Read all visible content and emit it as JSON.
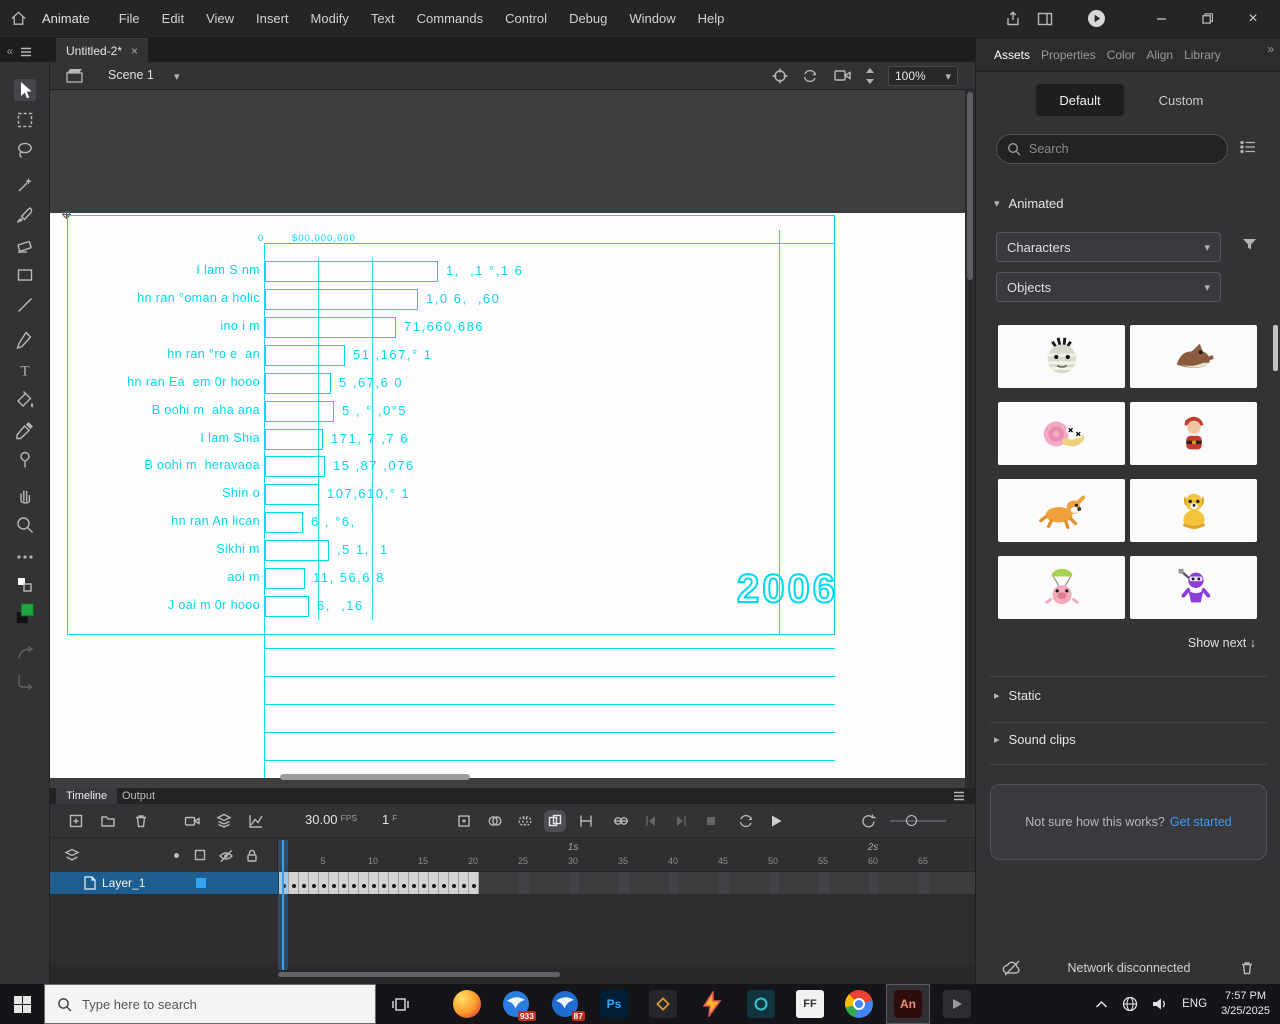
{
  "menubar": {
    "app": "Animate",
    "items": [
      "File",
      "Edit",
      "View",
      "Insert",
      "Modify",
      "Text",
      "Commands",
      "Control",
      "Debug",
      "Window",
      "Help"
    ]
  },
  "document": {
    "tab_title": "Untitled-2*"
  },
  "editbar": {
    "scene": "Scene 1",
    "zoom": "100%"
  },
  "stage": {
    "chart": {
      "axis_zero": "0",
      "axis_max": "$00,000,000",
      "watermark_year": "2006",
      "rows": [
        {
          "label": "I lam S nm",
          "value": "1,  ,1 °,1 6",
          "bar": 173
        },
        {
          "label": "hn ran °oman a holic",
          "value": "1,0 6,  ,60",
          "bar": 153
        },
        {
          "label": "ino i m",
          "value": "71,660,686",
          "bar": 131
        },
        {
          "label": "hn ran °ro e  an",
          "value": "51 ,167,° 1",
          "bar": 80
        },
        {
          "label": "hn ran Ea  em 0r hooo",
          "value": "5 ,67,6 0",
          "bar": 66
        },
        {
          "label": "B oohi m  aha ana",
          "value": "5 , ° ,0°5",
          "bar": 69
        },
        {
          "label": "I lam Shia",
          "value": "171, 7 ,7 6",
          "bar": 58
        },
        {
          "label": "B oohi m  heravaoa",
          "value": "15 ,87 ,076",
          "bar": 60
        },
        {
          "label": "Shin o",
          "value": "107,610,° 1",
          "bar": 54
        },
        {
          "label": "hn ran An lican",
          "value": "6 , °6,",
          "bar": 38
        },
        {
          "label": "Sikhi m",
          "value": ",5 1,  1",
          "bar": 64
        },
        {
          "label": "aoi m",
          "value": "11, 56,6 8",
          "bar": 40
        },
        {
          "label": "J oai m 0r hooo",
          "value": "6,  ,16",
          "bar": 44
        }
      ]
    }
  },
  "timeline": {
    "tabs": [
      "Timeline",
      "Output"
    ],
    "fps_value": "30.00",
    "fps_unit": "FPS",
    "frame_value": "1",
    "frame_unit": "F",
    "layer_name": "Layer_1",
    "keyframe_count": 20,
    "ruler_numbers": [
      5,
      10,
      15,
      20,
      25,
      30,
      35,
      40,
      45,
      50,
      55,
      60,
      65
    ],
    "time_marks": [
      "1s",
      "2s"
    ]
  },
  "assets_panel": {
    "tabs": [
      "Assets",
      "Properties",
      "Color",
      "Align",
      "Library"
    ],
    "active_tab": "Assets",
    "mode_default": "Default",
    "mode_custom": "Custom",
    "search_placeholder": "Search",
    "section_animated": "Animated",
    "dropdown_characters": "Characters",
    "dropdown_objects": "Objects",
    "items": [
      "mummy",
      "wolf",
      "snail",
      "santa",
      "dog-running",
      "dog-sitting",
      "pig-parachute",
      "ninja"
    ],
    "show_next": "Show next ↓",
    "section_static": "Static",
    "section_sound": "Sound clips",
    "help_text": "Not sure how this works?",
    "help_link": "Get started",
    "network_status": "Network disconnected"
  },
  "taskbar": {
    "search_placeholder": "Type here to search",
    "badge_mail_1": "933",
    "badge_mail_2": "87",
    "photoshop_label": "Ps",
    "ff_label": "FF",
    "animate_label": "An",
    "language": "ENG",
    "time": "7:57 PM",
    "date": "3/25/2025"
  }
}
